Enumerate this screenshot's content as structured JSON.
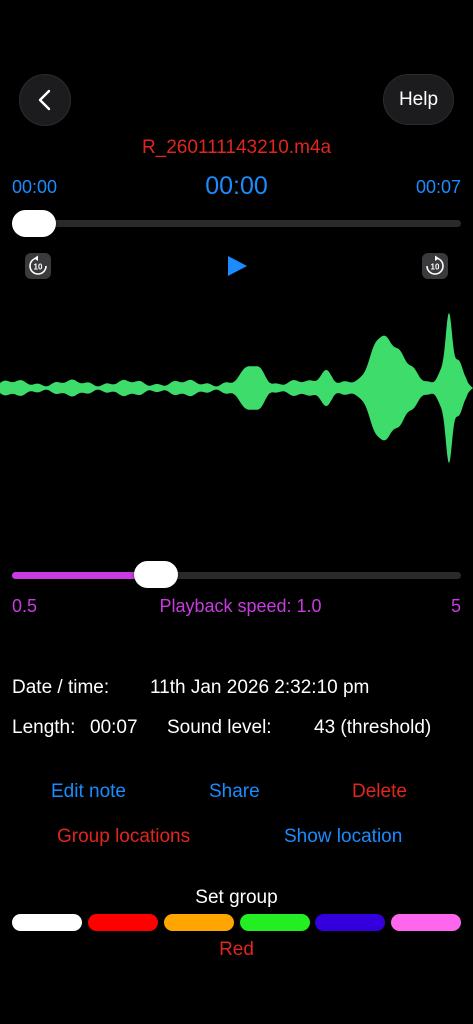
{
  "header": {
    "help_label": "Help",
    "filename": "R_260111143210.m4a"
  },
  "player": {
    "time_start": "00:00",
    "time_current": "00:00",
    "time_end": "00:07",
    "progress_fraction": 0.0
  },
  "speed": {
    "min_label": "0.5",
    "max_label": "5",
    "label": "Playback speed: 1.0",
    "value": 1.0,
    "min": 0.5,
    "max": 5
  },
  "info": {
    "date_label": "Date / time:",
    "date_value": "11th Jan 2026 2:32:10 pm",
    "length_label": "Length:",
    "length_value": "00:07",
    "sound_label": "Sound level:",
    "sound_value": "43 (threshold)"
  },
  "actions": {
    "edit_note": "Edit note",
    "share": "Share",
    "delete": "Delete",
    "group_locations": "Group locations",
    "show_location": "Show location"
  },
  "group": {
    "title": "Set group",
    "selected": "Red",
    "colors": [
      "#ffffff",
      "#ff0000",
      "#ffa500",
      "#22ee22",
      "#3300dd",
      "#ff66ee"
    ]
  },
  "colors": {
    "accent_blue": "#1a8cff",
    "accent_red": "#e0261d",
    "speed_purple": "#c83be0",
    "waveform_green": "#3ddc6b"
  }
}
